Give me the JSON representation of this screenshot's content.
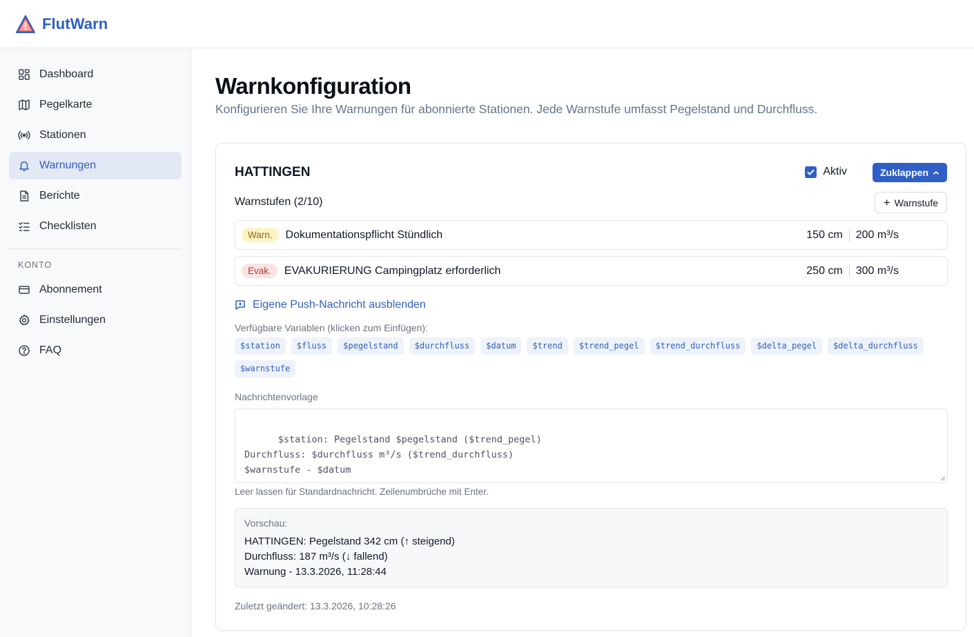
{
  "app": {
    "brand": "FlutWarn",
    "logo_icon": "warning-triangle-icon"
  },
  "sidebar": {
    "items": [
      {
        "label": "Dashboard",
        "icon": "dashboard-grid-icon"
      },
      {
        "label": "Pegelkarte",
        "icon": "map-icon"
      },
      {
        "label": "Stationen",
        "icon": "radio-broadcast-icon"
      },
      {
        "label": "Warnungen",
        "icon": "bell-icon",
        "active": true
      },
      {
        "label": "Berichte",
        "icon": "document-icon"
      },
      {
        "label": "Checklisten",
        "icon": "checklist-icon"
      }
    ],
    "section_title": "KONTO",
    "account_items": [
      {
        "label": "Abonnement",
        "icon": "credit-card-icon"
      },
      {
        "label": "Einstellungen",
        "icon": "gear-icon"
      },
      {
        "label": "FAQ",
        "icon": "help-circle-icon"
      }
    ]
  },
  "page": {
    "title": "Warnkonfiguration",
    "subtitle": "Konfigurieren Sie Ihre Warnungen für abonnierte Stationen. Jede Warnstufe umfasst Pegelstand und Durchfluss."
  },
  "station": {
    "name": "HATTINGEN",
    "active_label": "Aktiv",
    "active": true,
    "collapse_label": "Zuklappen",
    "levels_label": "Warnstufen (2/10)",
    "add_level_label": "Warnstufe",
    "levels": [
      {
        "badge": "Warn.",
        "name": "Dokumentationspflicht Stündlich",
        "level": "150 cm",
        "flow": "200 m³/s"
      },
      {
        "badge": "Evak.",
        "name": "EVAKURIERUNG Campingplatz erforderlich",
        "level": "250 cm",
        "flow": "300 m³/s"
      }
    ],
    "push_toggle_label": "Eigene Push-Nachricht ausblenden",
    "vars_label": "Verfügbare Variablen (klicken zum Einfügen):",
    "variables": [
      "$station",
      "$fluss",
      "$pegelstand",
      "$durchfluss",
      "$datum",
      "$trend",
      "$trend_pegel",
      "$trend_durchfluss",
      "$delta_pegel",
      "$delta_durchfluss",
      "$warnstufe"
    ],
    "template_label": "Nachrichtenvorlage",
    "template_text": "$station: Pegelstand $pegelstand ($trend_pegel)\nDurchfluss: $durchfluss m³/s ($trend_durchfluss)\n$warnstufe - $datum",
    "template_hint": "Leer lassen für Standardnachricht. Zeilenumbrüche mit Enter.",
    "preview_label": "Vorschau:",
    "preview_lines": [
      "HATTINGEN: Pegelstand 342 cm (↑ steigend)",
      "Durchfluss: 187 m³/s (↓ fallend)",
      "Warnung - 13.3.2026, 11:28:44"
    ],
    "last_changed": "Zuletzt geändert: 13.3.2026, 10:28:26"
  },
  "colors": {
    "accent": "#2f5fc4",
    "warn_badge_bg": "#fdf3c4",
    "evak_badge_bg": "#fbe3e3"
  }
}
